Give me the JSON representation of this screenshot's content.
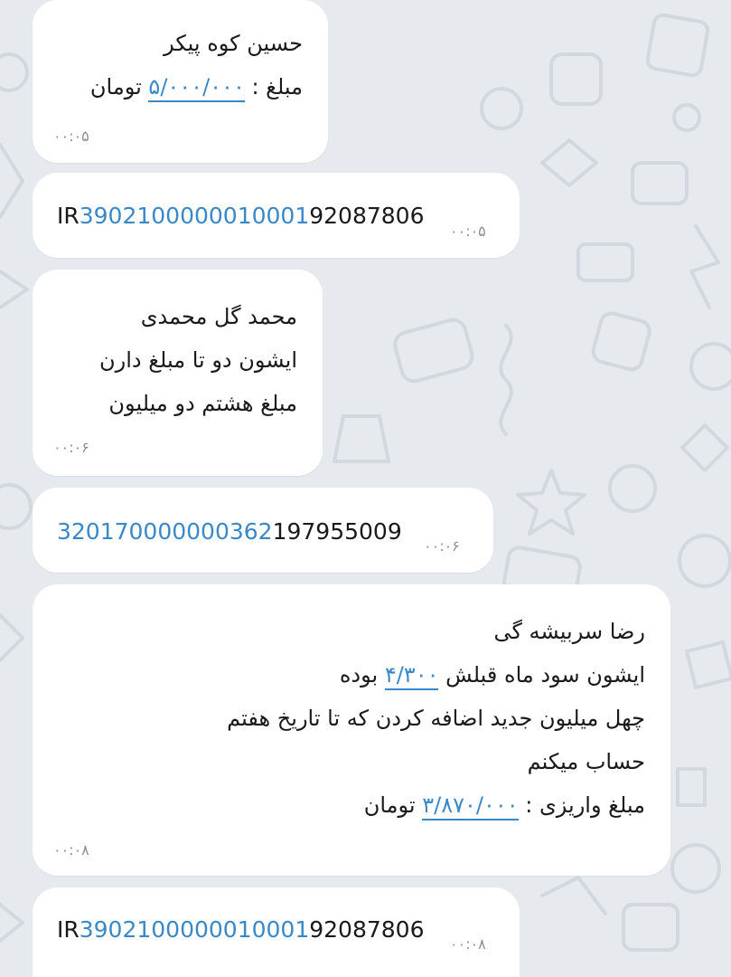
{
  "messages": [
    {
      "name_line": "حسین کوه پیکر",
      "amount_prefix": "مبلغ :",
      "amount_link": "۵/۰۰۰/۰۰۰",
      "amount_suffix": "تومان",
      "time": "۰۰:۰۵"
    },
    {
      "prefix": "IR",
      "highlight": "3902100000010001",
      "rest": "92087806",
      "time": "۰۰:۰۵"
    },
    {
      "line1": "محمد گل محمدی",
      "line2": "ایشون دو تا مبلغ دارن",
      "line3": "مبلغ هشتم دو میلیون",
      "time": "۰۰:۰۶"
    },
    {
      "highlight": "320170000000362",
      "rest": "197955009",
      "time": "۰۰:۰۶"
    },
    {
      "line1": "رضا سربیشه گی",
      "line2_prefix": "ایشون سود ماه قبلش",
      "line2_link": "۴/۳۰۰",
      "line2_suffix": "بوده",
      "line3": "چهل میلیون جدید اضافه کردن که تا تاریخ هفتم",
      "line4": "حساب میکنم",
      "amount_prefix": "مبلغ واریزی :",
      "amount_link": "۳/۸۷۰/۰۰۰",
      "amount_suffix": "تومان",
      "time": "۰۰:۰۸"
    },
    {
      "prefix": "IR",
      "highlight": "3902100000010001",
      "rest": "92087806",
      "time": "۰۰:۰۸"
    }
  ],
  "colors": {
    "background": "#e6eaef",
    "bubble": "#ffffff",
    "link": "#3a88c7",
    "time": "#8a9099"
  }
}
